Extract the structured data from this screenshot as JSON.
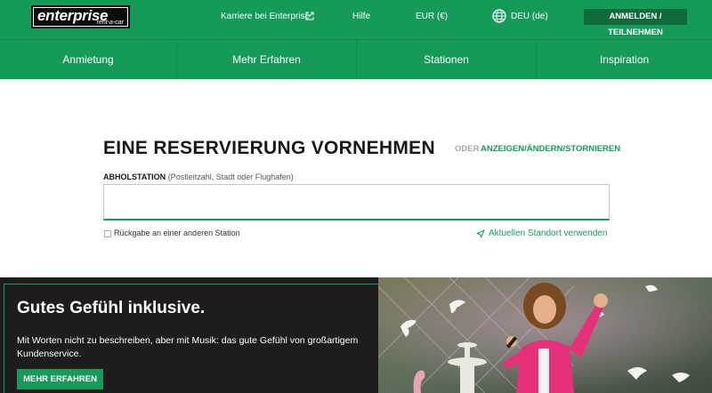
{
  "brand": {
    "name": "enterprise",
    "sub": "rent-a-car"
  },
  "topbar": {
    "careers": "Karriere bei Enterprise",
    "help": "Hilfe",
    "currency": "EUR (€)",
    "language": "DEU (de)",
    "login": "ANMELDEN / TEILNEHMEN"
  },
  "nav": {
    "items": [
      "Anmietung",
      "Mehr Erfahren",
      "Stationen",
      "Inspiration"
    ]
  },
  "reservation": {
    "title": "EINE RESERVIERUNG VORNEHMEN",
    "or": "ODER",
    "manage_link": "ANZEIGEN/ÄNDERN/STORNIEREN",
    "pickup_label": "ABHOLSTATION",
    "pickup_hint": "(Postleitzahl, Stadt oder Flughafen)",
    "pickup_value": "",
    "return_label": "Rückgabe an einer anderen Station",
    "location_label": "Aktuellen Standort verwenden"
  },
  "promo": {
    "title": "Gutes Gefühl inklusive.",
    "text": "Mit Worten nicht zu beschreiben, aber mit Musik: das gute Gefühl von großartigem Kundenservice.",
    "button": "MEHR ERFAHREN"
  },
  "colors": {
    "brand_green": "#169a5a",
    "dark_green": "#0f6b3c",
    "promo_bg": "#1d1d1d"
  }
}
